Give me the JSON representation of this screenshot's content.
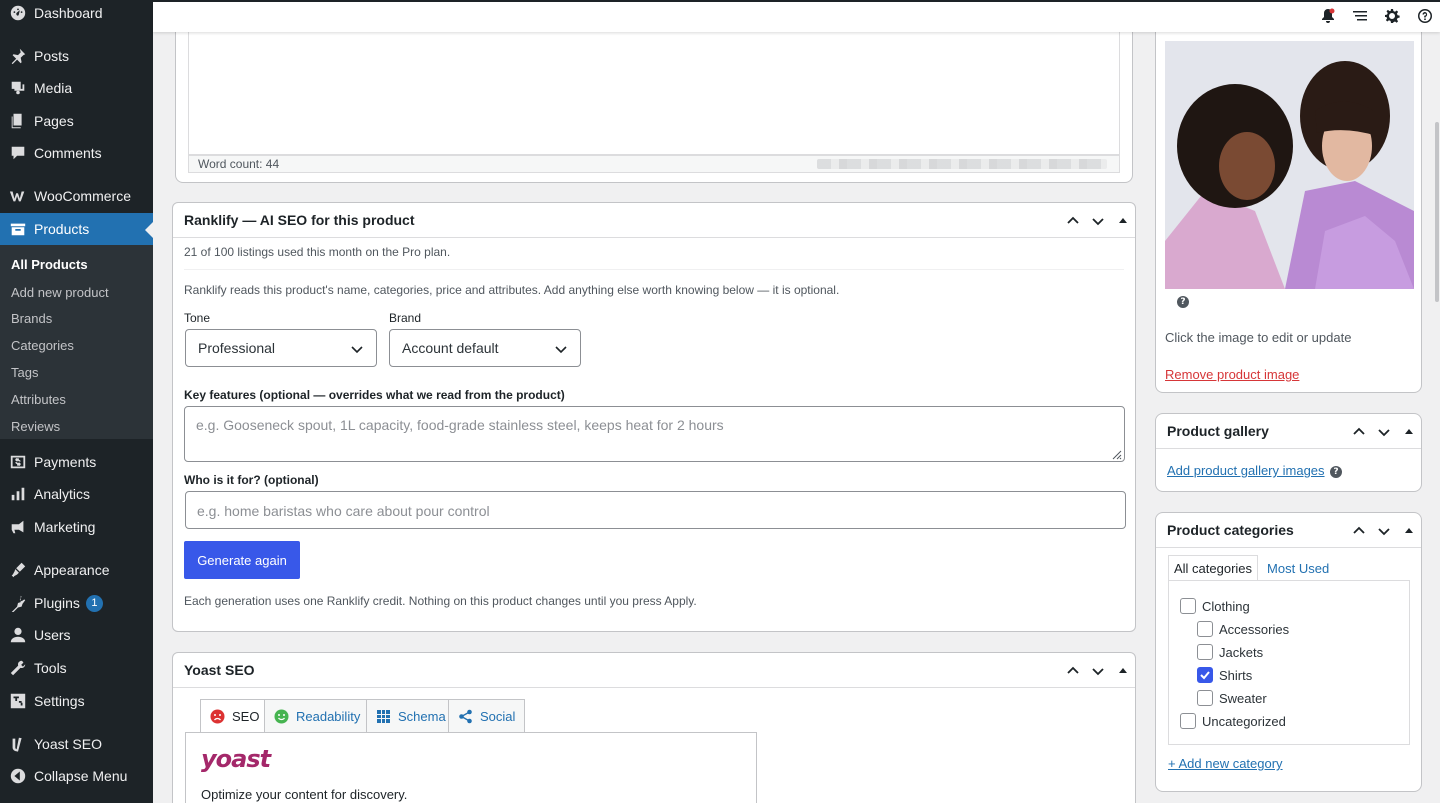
{
  "sidebar": {
    "items": [
      {
        "label": "Dashboard",
        "icon": "dashboard-icon"
      },
      {
        "label": "Posts",
        "icon": "pin-icon"
      },
      {
        "label": "Media",
        "icon": "media-icon"
      },
      {
        "label": "Pages",
        "icon": "pages-icon"
      },
      {
        "label": "Comments",
        "icon": "comments-icon"
      },
      {
        "label": "WooCommerce",
        "icon": "woocommerce-icon"
      },
      {
        "label": "Products",
        "icon": "products-icon"
      },
      {
        "label": "Payments",
        "icon": "payments-icon"
      },
      {
        "label": "Analytics",
        "icon": "analytics-icon"
      },
      {
        "label": "Marketing",
        "icon": "marketing-icon"
      },
      {
        "label": "Appearance",
        "icon": "appearance-icon"
      },
      {
        "label": "Plugins",
        "icon": "plugins-icon",
        "badge": "1"
      },
      {
        "label": "Users",
        "icon": "users-icon"
      },
      {
        "label": "Tools",
        "icon": "tools-icon"
      },
      {
        "label": "Settings",
        "icon": "settings-icon"
      },
      {
        "label": "Yoast SEO",
        "icon": "yoast-icon"
      },
      {
        "label": "Collapse Menu",
        "icon": "collapse-icon"
      }
    ],
    "submenu": [
      "All Products",
      "Add new product",
      "Brands",
      "Categories",
      "Tags",
      "Attributes",
      "Reviews"
    ]
  },
  "editor": {
    "word_count": "Word count: 44"
  },
  "ranklify": {
    "title": "Ranklify — AI SEO for this product",
    "usage": "21 of 100 listings used this month on the Pro plan.",
    "intro": "Ranklify reads this product's name, categories, price and attributes. Add anything else worth knowing below — it is optional.",
    "tone_label": "Tone",
    "tone_value": "Professional",
    "brand_label": "Brand",
    "brand_value": "Account default",
    "features_label": "Key features (optional — overrides what we read from the product)",
    "features_placeholder": "e.g. Gooseneck spout, 1L capacity, food-grade stainless steel, keeps heat for 2 hours",
    "audience_label": "Who is it for? (optional)",
    "audience_placeholder": "e.g. home baristas who care about pour control",
    "generate_button": "Generate again",
    "footnote": "Each generation uses one Ranklify credit. Nothing on this product changes until you press Apply."
  },
  "yoast": {
    "title": "Yoast SEO",
    "tabs": [
      {
        "label": "SEO",
        "icon": "sad-face-icon"
      },
      {
        "label": "Readability",
        "icon": "smile-face-icon"
      },
      {
        "label": "Schema",
        "icon": "grid-icon"
      },
      {
        "label": "Social",
        "icon": "share-icon"
      }
    ],
    "logo": "yoast",
    "tagline": "Optimize your content for discovery."
  },
  "product_image": {
    "help": "?",
    "click_hint": "Click the image to edit or update",
    "remove_link": "Remove product image"
  },
  "gallery": {
    "title": "Product gallery",
    "add_link": "Add product gallery images"
  },
  "categories": {
    "title": "Product categories",
    "tabs": [
      "All categories",
      "Most Used"
    ],
    "items": [
      {
        "label": "Clothing",
        "checked": false,
        "level": 0
      },
      {
        "label": "Accessories",
        "checked": false,
        "level": 1
      },
      {
        "label": "Jackets",
        "checked": false,
        "level": 1
      },
      {
        "label": "Shirts",
        "checked": true,
        "level": 1
      },
      {
        "label": "Sweater",
        "checked": false,
        "level": 1
      },
      {
        "label": "Uncategorized",
        "checked": false,
        "level": 0
      }
    ],
    "add_link": "+ Add new category"
  },
  "colors": {
    "sidebar_bg": "#1d2327",
    "accent": "#2271b1",
    "button_blue": "#3858e9",
    "danger": "#d63638",
    "yoast_brand": "#a4286a"
  }
}
